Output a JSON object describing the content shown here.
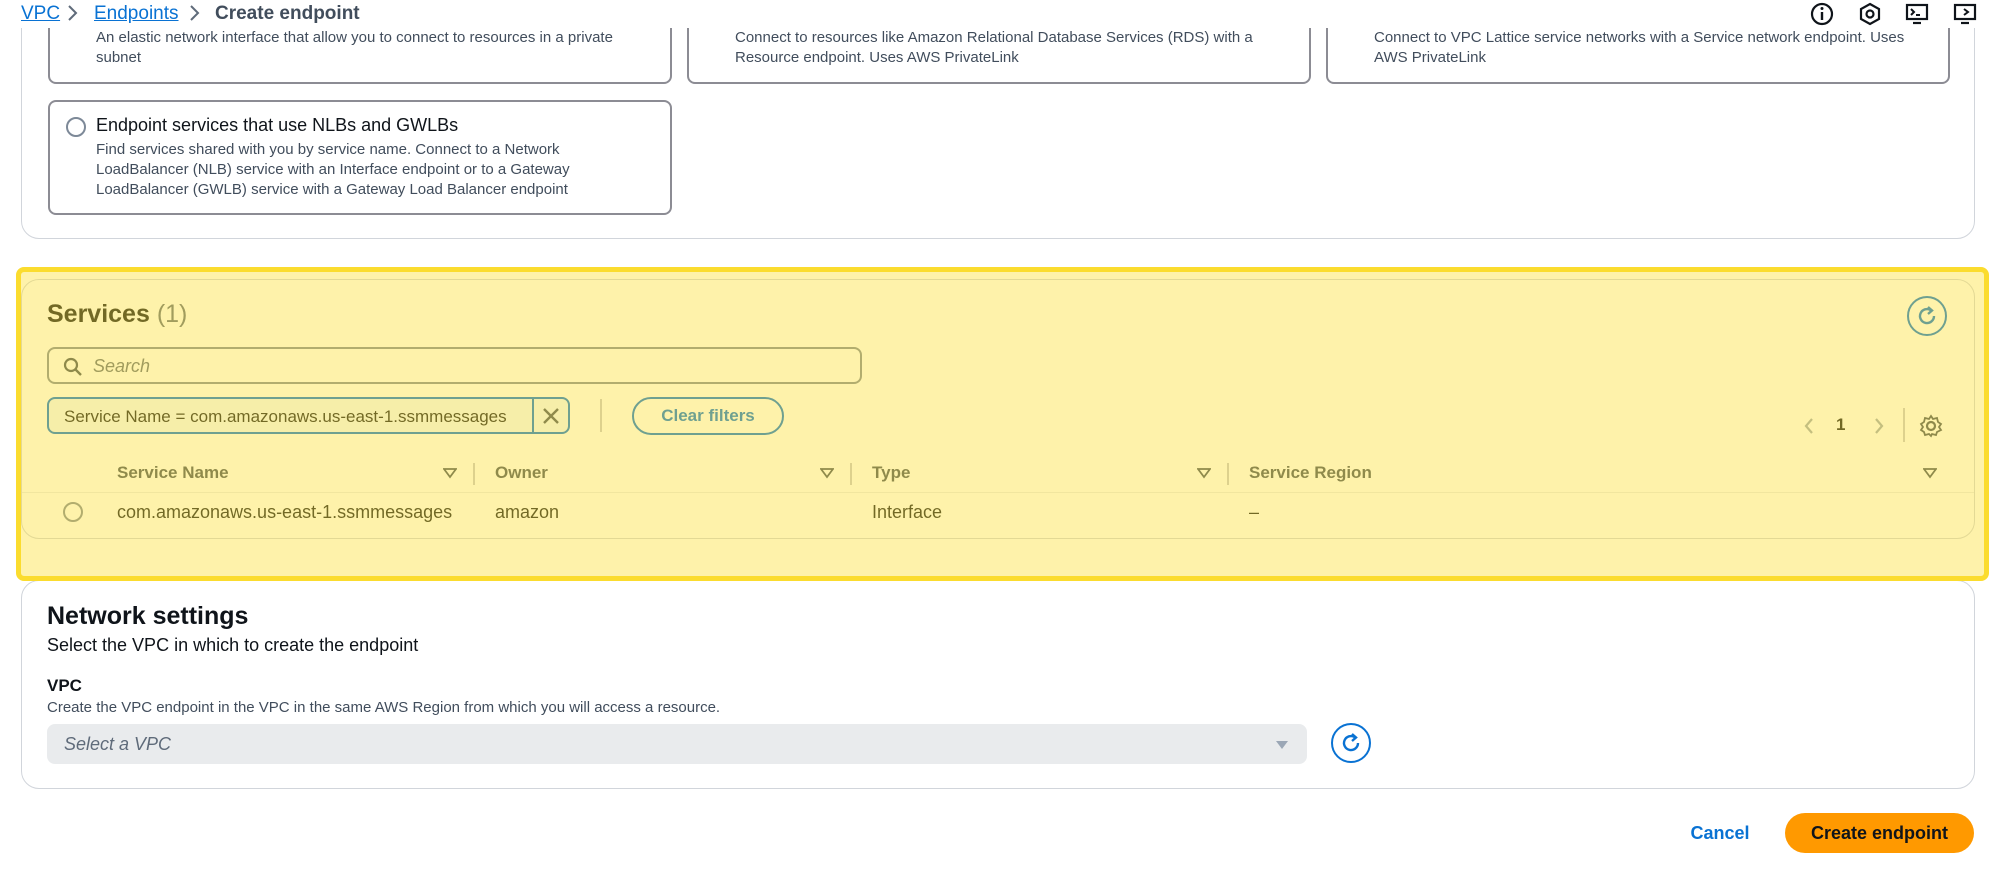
{
  "breadcrumb": {
    "items": [
      {
        "label": "VPC"
      },
      {
        "label": "Endpoints"
      },
      {
        "label": "Create endpoint"
      }
    ]
  },
  "utility_icons": [
    "info-icon",
    "settings-hex-icon",
    "cloudshell-icon",
    "notifications-monitor-icon"
  ],
  "endpoint_types": {
    "tiles": [
      {
        "lines": [
          "An elastic network interface that allow you to connect to resources in a private",
          "subnet"
        ]
      },
      {
        "lines": [
          "Connect to resources like Amazon Relational Database Services (RDS) with a",
          "Resource endpoint. Uses AWS PrivateLink"
        ]
      },
      {
        "lines": [
          "Connect to VPC Lattice service networks with a Service network endpoint. Uses",
          "AWS PrivateLink"
        ]
      },
      {
        "title": "Endpoint services that use NLBs and GWLBs",
        "lines": [
          "Find services shared with you by service name. Connect to a Network",
          "LoadBalancer (NLB) service with an Interface endpoint or to a Gateway",
          "LoadBalancer (GWLB) service with a Gateway Load Balancer endpoint"
        ]
      }
    ]
  },
  "services": {
    "title": "Services",
    "count": "(1)",
    "search_placeholder": "Search",
    "filter_token": "Service Name = com.amazonaws.us-east-1.ssmmessages",
    "clear_filters": "Clear filters",
    "page": "1",
    "columns": [
      "Service Name",
      "Owner",
      "Type",
      "Service Region"
    ],
    "rows": [
      {
        "service_name": "com.amazonaws.us-east-1.ssmmessages",
        "owner": "amazon",
        "type": "Interface",
        "region": "–"
      }
    ]
  },
  "network_settings": {
    "title": "Network settings",
    "description": "Select the VPC in which to create the endpoint",
    "vpc_label": "VPC",
    "vpc_description": "Create the VPC endpoint in the VPC in the same AWS Region from which you will access a resource.",
    "vpc_placeholder": "Select a VPC"
  },
  "actions": {
    "cancel": "Cancel",
    "create": "Create endpoint"
  },
  "colors": {
    "link": "#0972d3",
    "primary_button": "#ff9900",
    "highlight": "#fbdc2e"
  }
}
